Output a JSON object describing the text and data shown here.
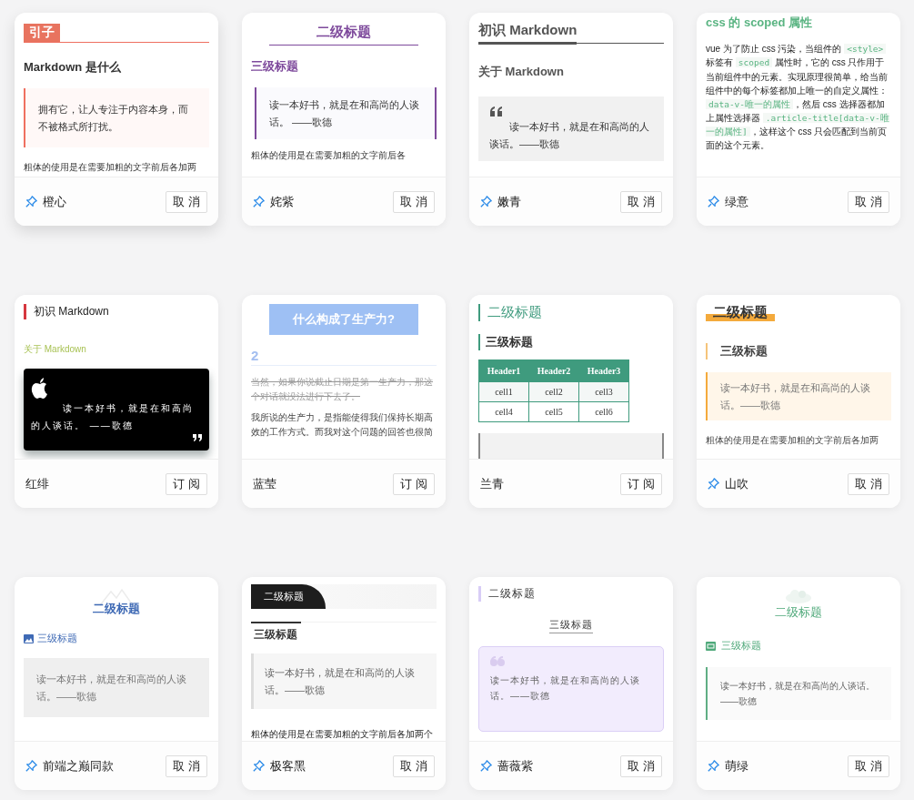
{
  "cards": [
    {
      "kind": "orange",
      "name": "橙心",
      "pinned": true,
      "button": "取消",
      "blocks": [
        {
          "kind": "h2",
          "text": "引子"
        },
        {
          "kind": "h3",
          "text": "Markdown 是什么"
        },
        {
          "kind": "quote",
          "text": "拥有它，让人专注于内容本身，而不被格式所打扰。"
        },
        {
          "kind": "para",
          "text": "粗体的使用是在需要加粗的文字前后各加两"
        }
      ]
    },
    {
      "kind": "purple",
      "name": "姹紫",
      "pinned": true,
      "button": "取消",
      "blocks": [
        {
          "kind": "h2",
          "text": "二级标题"
        },
        {
          "kind": "h3",
          "text": "三级标题"
        },
        {
          "kind": "quote",
          "text": "读一本好书，就是在和高尚的人谈话。 ——歌德"
        },
        {
          "kind": "para",
          "text": "粗体的使用是在需要加粗的文字前后各"
        }
      ]
    },
    {
      "kind": "cyan",
      "name": "嫩青",
      "pinned": true,
      "button": "取消",
      "blocks": [
        {
          "kind": "h2",
          "text": "初识 Markdown"
        },
        {
          "kind": "h3",
          "text": "关于 Markdown"
        },
        {
          "kind": "quote",
          "text": "读一本好书，就是在和高尚的人谈话。——歌德"
        }
      ]
    },
    {
      "kind": "green",
      "name": "绿意",
      "pinned": true,
      "button": "取消",
      "blocks": [
        {
          "kind": "h2",
          "text": "css 的 scoped 属性"
        },
        {
          "kind": "code-para",
          "segments": [
            {
              "kind": "text",
              "text": "vue 为了防止 css 污染，当组件的 "
            },
            {
              "kind": "code",
              "text": "<style>"
            },
            {
              "kind": "text",
              "text": " 标签有 "
            },
            {
              "kind": "code",
              "text": "scoped"
            },
            {
              "kind": "text",
              "text": " 属性时，它的 css 只作用于当前组件中的元素。实现原理很简单，给当前组件中的每个标签都加上唯一的自定义属性："
            },
            {
              "kind": "code",
              "text": "data-v-唯一的属性"
            },
            {
              "kind": "text",
              "text": "，然后 css 选择器都加上属性选择器 "
            },
            {
              "kind": "code",
              "text": ".article-title[data-v-唯一的属性]"
            },
            {
              "kind": "text",
              "text": "，这样这个 css 只会匹配到当前页面的这个元素。"
            }
          ]
        }
      ]
    },
    {
      "kind": "red",
      "name": "红绯",
      "pinned": false,
      "button": "订阅",
      "blocks": [
        {
          "kind": "h2",
          "text": "初识 Markdown"
        },
        {
          "kind": "h3",
          "text": "关于 Markdown"
        },
        {
          "kind": "quote",
          "text": "读一本好书，就是在和高尚的人谈话。 ——歌德"
        }
      ]
    },
    {
      "kind": "blue",
      "name": "蓝莹",
      "pinned": false,
      "button": "订阅",
      "blocks": [
        {
          "kind": "h2",
          "text": "什么构成了生产力?"
        },
        {
          "kind": "h3",
          "text": "2"
        },
        {
          "kind": "para",
          "struck": true,
          "text": "当然，如果你说截止日期是第一生产力，那这个对话就没法进行下去了。"
        },
        {
          "kind": "para",
          "struck": false,
          "text": "我所说的生产力，是指能使得我们保持长期高效的工作方式。而我对这个问题的回答也很简"
        }
      ]
    },
    {
      "kind": "teal",
      "name": "兰青",
      "pinned": false,
      "button": "订阅",
      "blocks": [
        {
          "kind": "h2",
          "text": "二级标题"
        },
        {
          "kind": "h3",
          "text": "三级标题"
        },
        {
          "kind": "table",
          "columns": [
            "Header1",
            "Header2",
            "Header3"
          ],
          "rows": [
            [
              "cell1",
              "cell2",
              "cell3"
            ],
            [
              "cell4",
              "cell5",
              "cell6"
            ]
          ]
        },
        {
          "kind": "quote-edge"
        }
      ]
    },
    {
      "kind": "yellow",
      "name": "山吹",
      "pinned": true,
      "button": "取消",
      "blocks": [
        {
          "kind": "h2",
          "text": "二级标题"
        },
        {
          "kind": "h3",
          "text": "三级标题"
        },
        {
          "kind": "quote",
          "text": "读一本好书，就是在和高尚的人谈话。——歌德"
        },
        {
          "kind": "para",
          "text": "粗体的使用是在需要加粗的文字前后各加两"
        }
      ]
    },
    {
      "kind": "summit",
      "name": "前端之巅同款",
      "pinned": true,
      "button": "取消",
      "blocks": [
        {
          "kind": "h2",
          "text": "二级标题"
        },
        {
          "kind": "h3",
          "text": "三级标题"
        },
        {
          "kind": "quote",
          "text": "读一本好书，就是在和高尚的人谈话。——歌德"
        }
      ]
    },
    {
      "kind": "geek",
      "name": "极客黑",
      "pinned": true,
      "button": "取消",
      "blocks": [
        {
          "kind": "h2",
          "text": "二级标题"
        },
        {
          "kind": "h3",
          "text": "三级标题"
        },
        {
          "kind": "quote",
          "text": "读一本好书，就是在和高尚的人谈话。——歌德"
        },
        {
          "kind": "para",
          "text": "粗体的使用是在需要加粗的文字前后各加两个"
        }
      ]
    },
    {
      "kind": "rose",
      "name": "蔷薇紫",
      "pinned": true,
      "button": "取消",
      "blocks": [
        {
          "kind": "h2",
          "text": "二级标题"
        },
        {
          "kind": "h3",
          "text": "三级标题"
        },
        {
          "kind": "quote",
          "text": "读一本好书，就是在和高尚的人谈话。——歌德"
        }
      ]
    },
    {
      "kind": "mint",
      "name": "萌绿",
      "pinned": true,
      "button": "取消",
      "blocks": [
        {
          "kind": "h2",
          "text": "二级标题"
        },
        {
          "kind": "h3",
          "text": "三级标题"
        },
        {
          "kind": "quote",
          "text": "读一本好书，就是在和高尚的人谈话。——歌德"
        }
      ]
    }
  ]
}
